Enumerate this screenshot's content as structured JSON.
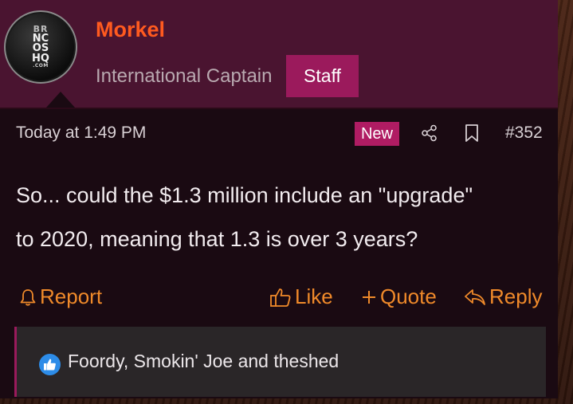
{
  "user": {
    "name": "Morkel",
    "title": "International Captain",
    "badge": "Staff",
    "avatar_logo": [
      "BR",
      "NC",
      "OS",
      "HQ",
      ".COM"
    ]
  },
  "meta": {
    "timestamp": "Today at 1:49 PM",
    "new_badge": "New",
    "post_number": "#352"
  },
  "message": {
    "line1": "So... could the $1.3 million include an \"upgrade\"",
    "line2": "to 2020, meaning that 1.3 is over 3 years?"
  },
  "actions": {
    "report": "Report",
    "like": "Like",
    "quote": "Quote",
    "reply": "Reply"
  },
  "reactions": {
    "text": "Foordy, Smokin' Joe and theshed",
    "icon": "thumbs-up-icon"
  },
  "colors": {
    "accent": "#ff5a1f",
    "action": "#f08a2a",
    "badge": "#9b1a5c",
    "header_bg": "#4a1430"
  }
}
